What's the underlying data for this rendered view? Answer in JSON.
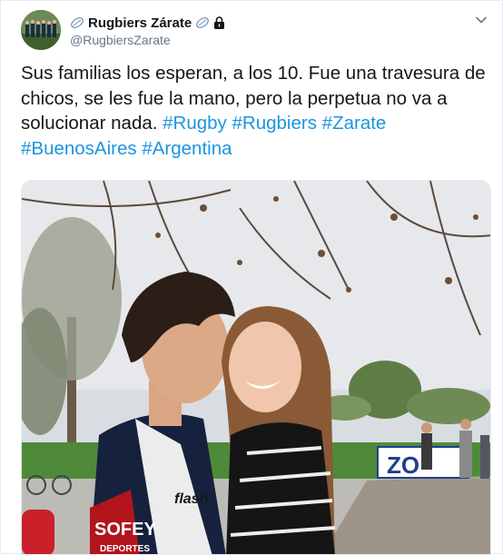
{
  "account": {
    "name": "Rugbiers Zárate",
    "handle": "@RugbiersZarate",
    "name_prefix_icon": "rugby-ball-icon",
    "name_suffix_icons": [
      "rugby-ball-icon",
      "lock-icon"
    ]
  },
  "tweet": {
    "text_plain": "Sus familias los esperan, a los 10. Fue una travesura de chicos, se les fue la mano, pero la perpetua no va a solucionar nada. ",
    "hashtags": [
      "#Rugby",
      "#Rugbiers",
      "#Zarate",
      "#BuenosAires",
      "#Argentina"
    ]
  },
  "media": {
    "banner_text": "ZO",
    "shirt_text_1": "flash",
    "shirt_text_2": "SOFEY",
    "shirt_text_3": "DEPORTES"
  },
  "colors": {
    "link": "#1b95e0",
    "text": "#14171a",
    "muted": "#657786"
  }
}
